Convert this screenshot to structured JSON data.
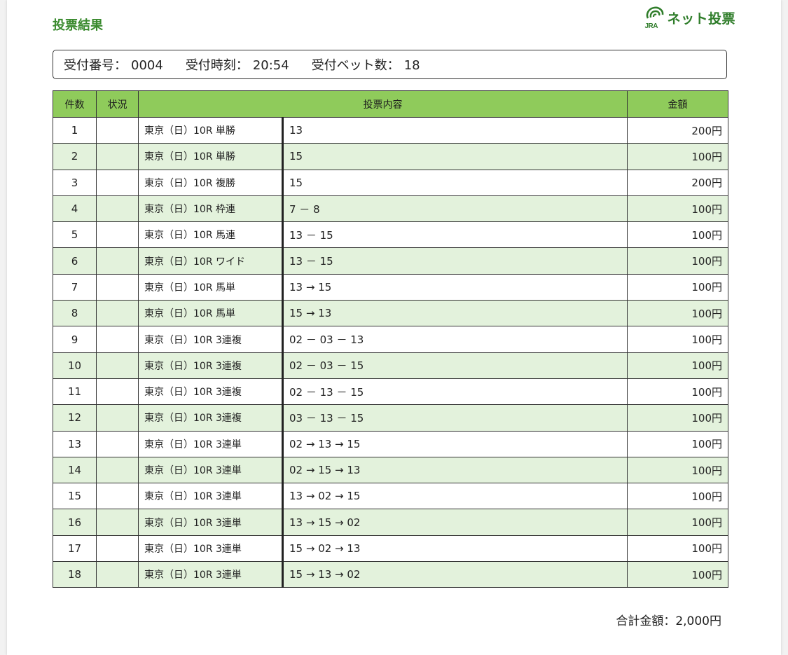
{
  "header": {
    "title": "投票結果",
    "logo_text": "ネット投票",
    "logo_brand": "JRA"
  },
  "info": {
    "receipt_label": "受付番号：",
    "receipt_value": "0004",
    "time_label": "受付時刻：",
    "time_value": "20:54",
    "count_label": "受付ベット数：",
    "count_value": "18"
  },
  "table": {
    "columns": [
      "件数",
      "状況",
      "投票内容",
      "金額"
    ],
    "rows": [
      {
        "no": "1",
        "status": "",
        "race": "東京（日）10R 単勝",
        "content": "13",
        "amount": "200円"
      },
      {
        "no": "2",
        "status": "",
        "race": "東京（日）10R 単勝",
        "content": "15",
        "amount": "100円"
      },
      {
        "no": "3",
        "status": "",
        "race": "東京（日）10R 複勝",
        "content": "15",
        "amount": "200円"
      },
      {
        "no": "4",
        "status": "",
        "race": "東京（日）10R 枠連",
        "content": "7 － 8",
        "amount": "100円"
      },
      {
        "no": "5",
        "status": "",
        "race": "東京（日）10R 馬連",
        "content": "13 － 15",
        "amount": "100円"
      },
      {
        "no": "6",
        "status": "",
        "race": "東京（日）10R ワイド",
        "content": "13 － 15",
        "amount": "100円"
      },
      {
        "no": "7",
        "status": "",
        "race": "東京（日）10R 馬単",
        "content": "13 → 15",
        "amount": "100円"
      },
      {
        "no": "8",
        "status": "",
        "race": "東京（日）10R 馬単",
        "content": "15 → 13",
        "amount": "100円"
      },
      {
        "no": "9",
        "status": "",
        "race": "東京（日）10R 3連複",
        "content": "02 － 03 － 13",
        "amount": "100円"
      },
      {
        "no": "10",
        "status": "",
        "race": "東京（日）10R 3連複",
        "content": "02 － 03 － 15",
        "amount": "100円"
      },
      {
        "no": "11",
        "status": "",
        "race": "東京（日）10R 3連複",
        "content": "02 － 13 － 15",
        "amount": "100円"
      },
      {
        "no": "12",
        "status": "",
        "race": "東京（日）10R 3連複",
        "content": "03 － 13 － 15",
        "amount": "100円"
      },
      {
        "no": "13",
        "status": "",
        "race": "東京（日）10R 3連単",
        "content": "02 → 13 → 15",
        "amount": "100円"
      },
      {
        "no": "14",
        "status": "",
        "race": "東京（日）10R 3連単",
        "content": "02 → 15 → 13",
        "amount": "100円"
      },
      {
        "no": "15",
        "status": "",
        "race": "東京（日）10R 3連単",
        "content": "13 → 02 → 15",
        "amount": "100円"
      },
      {
        "no": "16",
        "status": "",
        "race": "東京（日）10R 3連単",
        "content": "13 → 15 → 02",
        "amount": "100円"
      },
      {
        "no": "17",
        "status": "",
        "race": "東京（日）10R 3連単",
        "content": "15 → 02 → 13",
        "amount": "100円"
      },
      {
        "no": "18",
        "status": "",
        "race": "東京（日）10R 3連単",
        "content": "15 → 13 → 02",
        "amount": "100円"
      }
    ]
  },
  "total": {
    "label": "合計金額：",
    "value": "2,000円"
  },
  "colors": {
    "title_green": "#3a8a2e",
    "header_green": "#8fcb5b",
    "row_alt_green": "#e3f2dc",
    "logo_green": "#2f7d2a"
  }
}
